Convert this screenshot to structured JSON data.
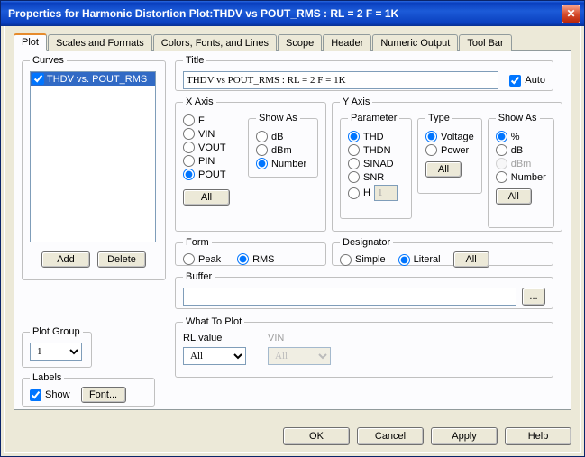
{
  "window": {
    "title": "Properties for Harmonic Distortion Plot:THDV vs POUT_RMS : RL = 2 F = 1K"
  },
  "tabs": [
    "Plot",
    "Scales and Formats",
    "Colors, Fonts, and Lines",
    "Scope",
    "Header",
    "Numeric Output",
    "Tool Bar"
  ],
  "curves": {
    "legend": "Curves",
    "items": [
      "THDV vs. POUT_RMS"
    ],
    "add": "Add",
    "delete": "Delete"
  },
  "plotgroup": {
    "legend": "Plot Group",
    "value": "1"
  },
  "labels": {
    "legend": "Labels",
    "show": "Show",
    "font": "Font..."
  },
  "titleBox": {
    "legend": "Title",
    "value": "THDV vs POUT_RMS : RL = 2 F = 1K",
    "auto": "Auto"
  },
  "xaxis": {
    "legend": "X Axis",
    "opts": [
      "F",
      "VIN",
      "VOUT",
      "PIN",
      "POUT"
    ],
    "all": "All",
    "showas": {
      "legend": "Show As",
      "opts": [
        "dB",
        "dBm",
        "Number"
      ]
    }
  },
  "yaxis": {
    "legend": "Y Axis",
    "param": {
      "legend": "Parameter",
      "opts": [
        "THD",
        "THDN",
        "SINAD",
        "SNR",
        "H"
      ],
      "hval": "1"
    },
    "type": {
      "legend": "Type",
      "opts": [
        "Voltage",
        "Power"
      ],
      "all": "All"
    },
    "showas": {
      "legend": "Show As",
      "opts": [
        "%",
        "dB",
        "dBm",
        "Number"
      ],
      "all": "All"
    }
  },
  "form": {
    "legend": "Form",
    "opts": [
      "Peak",
      "RMS"
    ]
  },
  "designator": {
    "legend": "Designator",
    "opts": [
      "Simple",
      "Literal"
    ],
    "all": "All"
  },
  "buffer": {
    "legend": "Buffer",
    "value": "",
    "browse": "..."
  },
  "wtp": {
    "legend": "What To Plot",
    "rl": {
      "label": "RL.value",
      "value": "All"
    },
    "vin": {
      "label": "VIN",
      "value": "All"
    }
  },
  "footer": {
    "ok": "OK",
    "cancel": "Cancel",
    "apply": "Apply",
    "help": "Help"
  }
}
